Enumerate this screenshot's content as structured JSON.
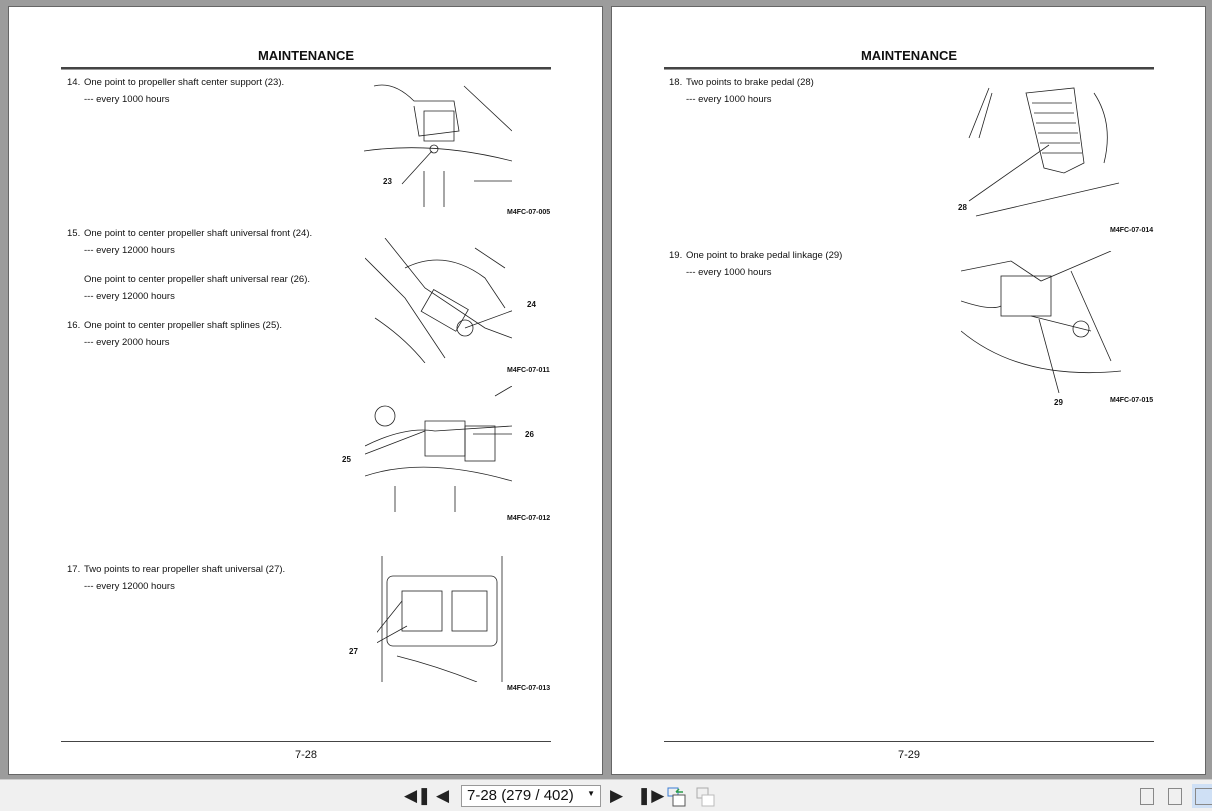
{
  "section_title": "MAINTENANCE",
  "left_page": {
    "page_number": "7-28",
    "items": [
      {
        "number": "14.",
        "text": "One point to propeller shaft center support (23).",
        "interval": "--- every 1000 hours"
      },
      {
        "number": "15.",
        "text": "One point to center propeller shaft universal front (24).",
        "interval": "--- every 12000 hours"
      },
      {
        "number": "",
        "text": "One point to center propeller shaft universal rear (26).",
        "interval": "--- every 12000 hours"
      },
      {
        "number": "16.",
        "text": "One point to center propeller shaft splines (25).",
        "interval": "--- every 2000 hours"
      },
      {
        "number": "17.",
        "text": "Two points to rear propeller shaft universal (27).",
        "interval": "--- every 12000 hours"
      }
    ],
    "figures": [
      {
        "caption": "M4FC-07-005",
        "labels": [
          "23"
        ]
      },
      {
        "caption": "M4FC-07-011",
        "labels": [
          "24"
        ]
      },
      {
        "caption": "M4FC-07-012",
        "labels": [
          "25",
          "26"
        ]
      },
      {
        "caption": "M4FC-07-013",
        "labels": [
          "27"
        ]
      }
    ]
  },
  "right_page": {
    "page_number": "7-29",
    "items": [
      {
        "number": "18.",
        "text": "Two points to brake pedal (28)",
        "interval": "--- every 1000 hours"
      },
      {
        "number": "19.",
        "text": "One point to brake pedal linkage (29)",
        "interval": "--- every 1000 hours"
      }
    ],
    "figures": [
      {
        "caption": "M4FC-07-014",
        "labels": [
          "28"
        ]
      },
      {
        "caption": "M4FC-07-015",
        "labels": [
          "29"
        ]
      }
    ]
  },
  "toolbar": {
    "page_select": "7-28 (279 / 402)"
  }
}
